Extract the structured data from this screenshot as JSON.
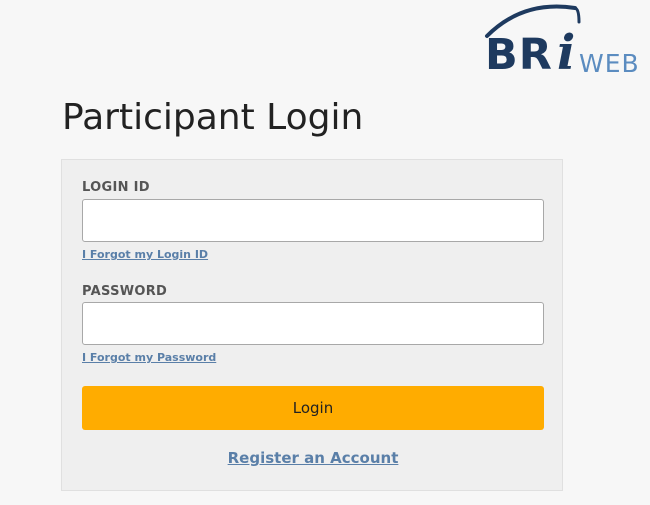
{
  "logo": {
    "bri": "BR",
    "i": "i",
    "web": "WEB",
    "colors": {
      "primary": "#1e3a5f",
      "secondary": "#5b8cc0"
    }
  },
  "page": {
    "title": "Participant Login"
  },
  "form": {
    "login_id_label": "LOGIN ID",
    "login_id_value": "",
    "forgot_login_id": "I Forgot my Login ID",
    "password_label": "PASSWORD",
    "password_value": "",
    "forgot_password": "I Forgot my Password",
    "login_button": "Login",
    "register_link": "Register an Account"
  },
  "colors": {
    "background": "#f7f7f7",
    "panel": "#efefef",
    "button": "#ffac00",
    "link": "#5a7fa8"
  }
}
